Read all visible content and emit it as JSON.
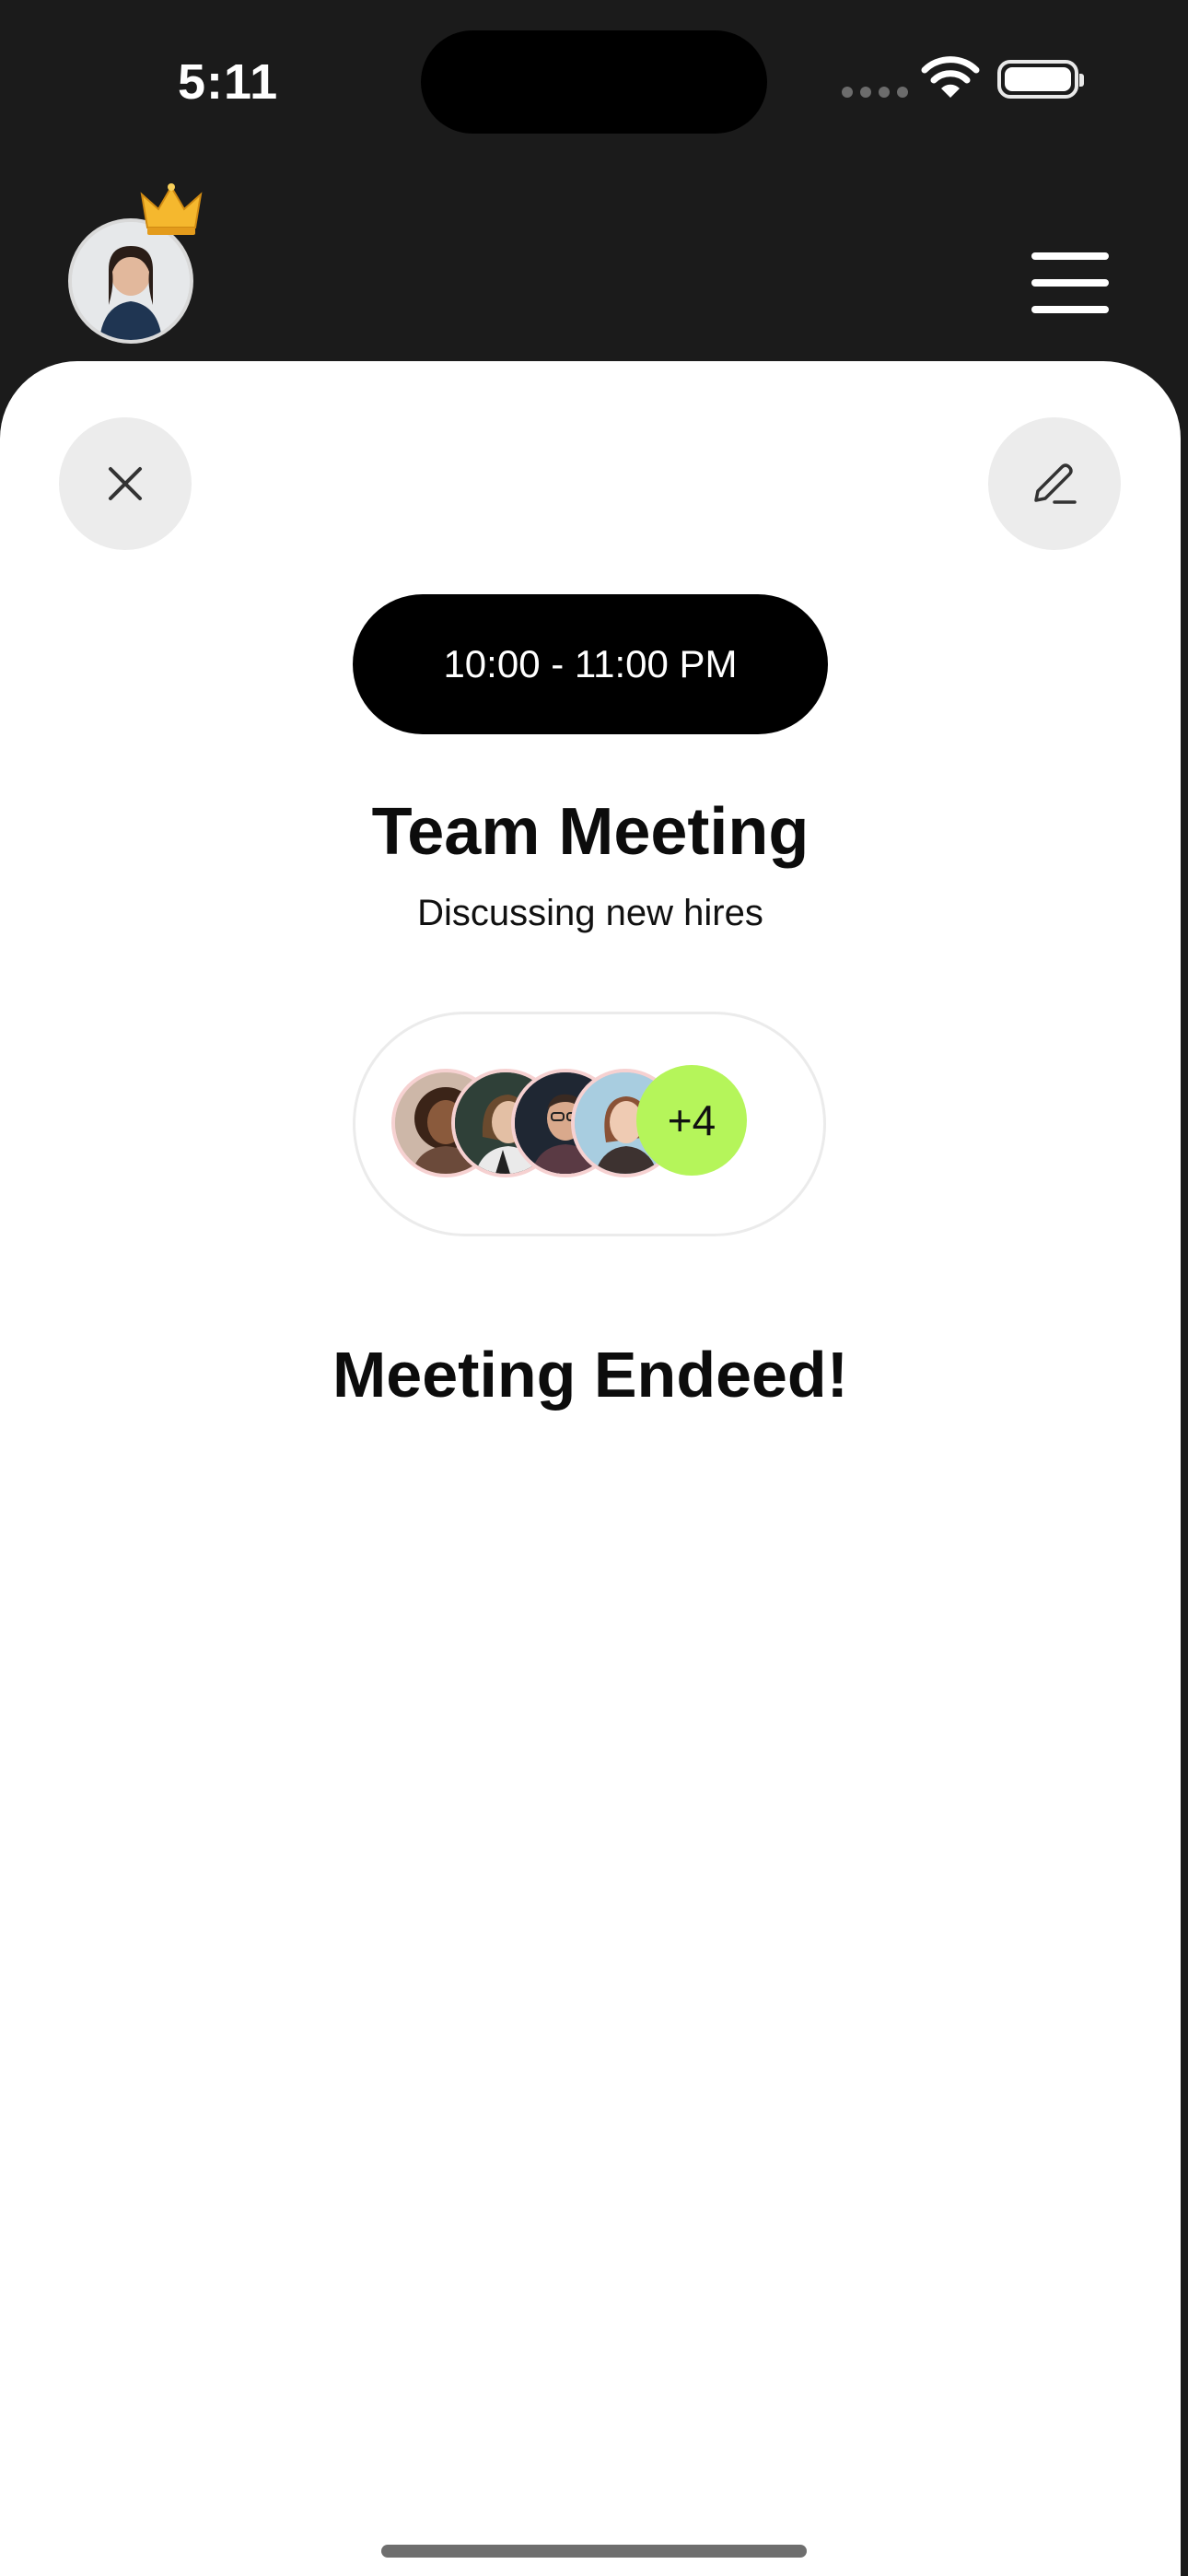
{
  "status_bar": {
    "time": "5:11",
    "icons": [
      "signal-dots-icon",
      "wifi-icon",
      "battery-icon"
    ]
  },
  "header": {
    "avatar_icon": "user-avatar",
    "crown_icon": "crown-icon",
    "menu_icon": "hamburger-menu-icon"
  },
  "sheet": {
    "close_icon": "close-icon",
    "edit_icon": "pencil-icon",
    "time_range": "10:00 - 11:00 PM",
    "title": "Team Meeting",
    "subtitle": "Discussing new hires",
    "participants": {
      "avatars": [
        "participant-1",
        "participant-2",
        "participant-3",
        "participant-4"
      ],
      "more_label": "+4"
    },
    "status_message": "Meeting Endeed!"
  },
  "colors": {
    "background_dark": "#1b1b1b",
    "sheet": "#ffffff",
    "pill": "#000000",
    "accent_green": "#b5f55a",
    "crown_gold": "#f5b82e",
    "button_gray": "#ececec"
  }
}
